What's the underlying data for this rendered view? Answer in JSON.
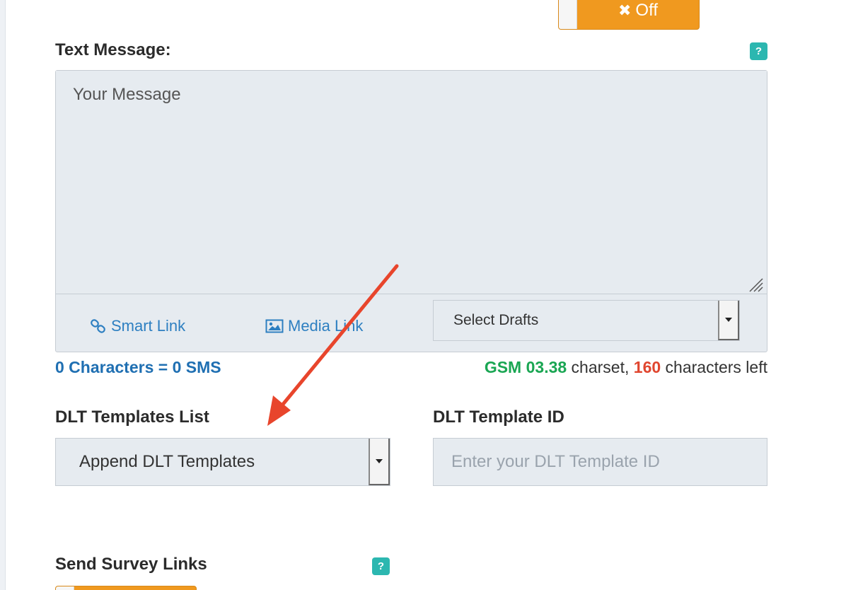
{
  "toggle_top": {
    "label": "Off"
  },
  "text_message": {
    "label": "Text Message:",
    "help": "?",
    "placeholder": "Your Message",
    "value": ""
  },
  "toolbar": {
    "smart_link": "Smart Link",
    "media_link": "Media Link",
    "drafts_select": "Select Drafts"
  },
  "counter": {
    "text": "0 Characters = 0 SMS"
  },
  "charset": {
    "name": "GSM 03.38",
    "suffix": " charset, ",
    "remaining": "160",
    "remaining_suffix": " characters left"
  },
  "dlt": {
    "list_label": "DLT Templates List",
    "list_selected": "Append DLT Templates",
    "id_label": "DLT Template ID",
    "id_placeholder": "Enter your DLT Template ID",
    "id_value": ""
  },
  "survey": {
    "label": "Send Survey Links",
    "help": "?"
  },
  "colors": {
    "accent_orange": "#f0991f",
    "help_teal": "#2cb7b0",
    "link_blue": "#2d7fc1",
    "gsm_green": "#1aa653",
    "remaining_red": "#e0462f",
    "annotation_arrow": "#e8452c"
  }
}
